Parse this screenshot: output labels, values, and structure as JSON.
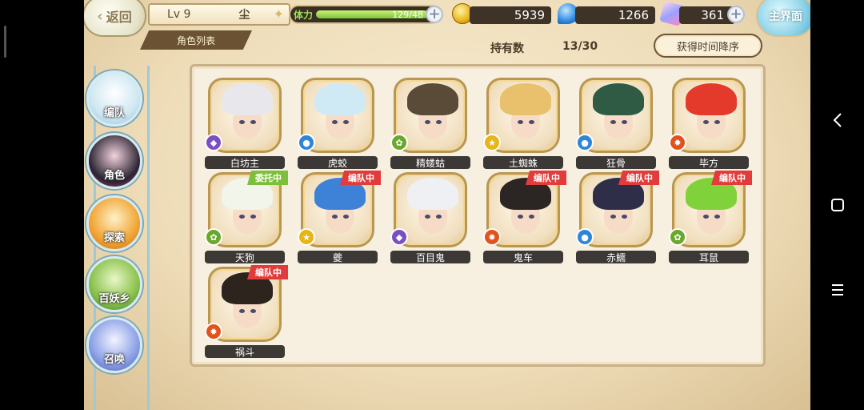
{
  "header": {
    "back_label": "返回",
    "level": "Lv 9",
    "player_name": "尘",
    "tab_label": "角色列表",
    "home_label": "主界面"
  },
  "stamina": {
    "label": "体力",
    "value_text": "129/48",
    "fill_fraction": 1.0
  },
  "resources": {
    "coins": "5939",
    "souls": "1266",
    "gems": "361"
  },
  "collection": {
    "owned_label": "持有数",
    "owned_value": "13/30",
    "sort_label": "获得时间降序"
  },
  "sidebar": {
    "items": [
      {
        "label": "编队"
      },
      {
        "label": "角色"
      },
      {
        "label": "探索"
      },
      {
        "label": "百妖乡"
      },
      {
        "label": "召唤"
      }
    ]
  },
  "characters": [
    {
      "name": "白坊主",
      "badge": "",
      "element": "purple",
      "hair": "#e8e8ec"
    },
    {
      "name": "虎蛟",
      "badge": "",
      "element": "blue",
      "hair": "#cfeaf4"
    },
    {
      "name": "精蝼蛄",
      "badge": "",
      "element": "green",
      "hair": "#5a4a38"
    },
    {
      "name": "土蜘蛛",
      "badge": "",
      "element": "yellow",
      "hair": "#e9c06c"
    },
    {
      "name": "狂骨",
      "badge": "",
      "element": "blue",
      "hair": "#2f5a43"
    },
    {
      "name": "毕方",
      "badge": "",
      "element": "orange",
      "hair": "#e43a2c"
    },
    {
      "name": "天狗",
      "badge": "委托中",
      "element": "green",
      "hair": "#f1f5ea"
    },
    {
      "name": "夔",
      "badge": "编队中",
      "element": "yellow",
      "hair": "#3d82d6"
    },
    {
      "name": "百目鬼",
      "badge": "",
      "element": "purple",
      "hair": "#eef0f4"
    },
    {
      "name": "鬼车",
      "badge": "编队中",
      "element": "orange",
      "hair": "#2b2523"
    },
    {
      "name": "赤鱬",
      "badge": "编队中",
      "element": "blue",
      "hair": "#2e2e48"
    },
    {
      "name": "耳鼠",
      "badge": "编队中",
      "element": "green",
      "hair": "#7fd23a"
    },
    {
      "name": "祸斗",
      "badge": "编队中",
      "element": "orange",
      "hair": "#2d241d"
    }
  ],
  "colors": {
    "badge_team": "#e23b3b",
    "badge_commission": "#7cbf3a",
    "element_purple": "#7a4fc0",
    "element_blue": "#2f86d8",
    "element_green": "#6aa82c",
    "element_yellow": "#e8b417",
    "element_orange": "#e2521c"
  }
}
